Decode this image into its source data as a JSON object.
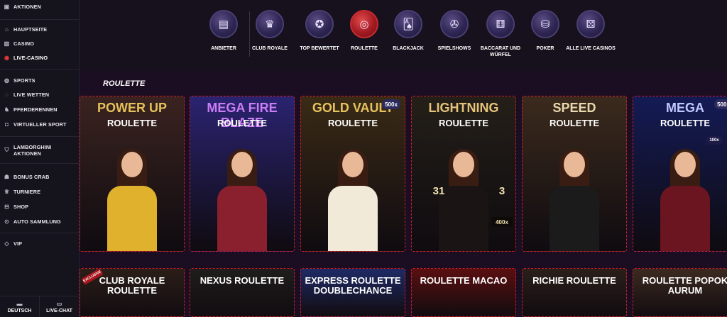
{
  "sidebar": {
    "top_items": [
      {
        "label": "AKTIONEN",
        "icon": "gift-icon"
      }
    ],
    "group1": [
      {
        "label": "HAUPTSEITE",
        "icon": "home-icon"
      },
      {
        "label": "CASINO",
        "icon": "slot-icon"
      },
      {
        "label": "LIVE-CASINO",
        "icon": "roulette-icon"
      }
    ],
    "group2": [
      {
        "label": "SPORTS",
        "icon": "ball-icon"
      },
      {
        "label": "LIVE WETTEN",
        "icon": "live-icon"
      },
      {
        "label": "PFERDERENNEN",
        "icon": "horse-icon"
      },
      {
        "label": "VIRTUELLER SPORT",
        "icon": "controller-icon"
      }
    ],
    "lambo": {
      "line1": "LAMBORGHINI",
      "line2": "AKTIONEN"
    },
    "group3": [
      {
        "label": "BONUS CRAB",
        "icon": "crab-icon"
      },
      {
        "label": "TURNIERE",
        "icon": "trophy-icon"
      },
      {
        "label": "SHOP",
        "icon": "shop-icon"
      },
      {
        "label": "AUTO SAMMLUNG",
        "icon": "car-icon"
      }
    ],
    "vip": {
      "label": "VIP",
      "icon": "vip-icon"
    },
    "bottom": {
      "language": "DEUTSCH",
      "chat": "LIVE-CHAT"
    }
  },
  "categories": [
    {
      "label": "ANBIETER",
      "icon": "provider-icon",
      "glyph": "▤"
    },
    {
      "label": "CLUB ROYALE",
      "icon": "crown-icon",
      "glyph": "♛"
    },
    {
      "label": "TOP BEWERTET",
      "icon": "badge-icon",
      "glyph": "✪"
    },
    {
      "label": "ROULETTE",
      "icon": "roulette-wheel-icon",
      "glyph": "◎",
      "active": true
    },
    {
      "label": "BLACKJACK",
      "icon": "cards-icon",
      "glyph": "🂡"
    },
    {
      "label": "SPIELSHOWS",
      "icon": "wheel-icon",
      "glyph": "✇"
    },
    {
      "label": "BACCARAT UND WÜRFEL",
      "icon": "dice-cards-icon",
      "glyph": "⚅"
    },
    {
      "label": "POKER",
      "icon": "chips-icon",
      "glyph": "⛁"
    },
    {
      "label": "ALLE LIVE CASINOS",
      "icon": "all-live-icon",
      "glyph": "⚄"
    }
  ],
  "section_title": "ROULETTE",
  "games_row1": [
    {
      "caption": "PowerUP Roulette",
      "title1": "POWER UP",
      "title2": "ROULETTE",
      "bg": "#3a2320",
      "accent": "#e4c15a",
      "dress": "#e0b12c"
    },
    {
      "caption": "Mega Fire Blaze Roulette Live",
      "title1": "MEGA FIRE BLAZE",
      "title2": "ROULETTE",
      "bg": "#2a2370",
      "accent": "#c97cf4",
      "dress": "#8a1f2e"
    },
    {
      "caption": "Gold Vault Roulette",
      "title1": "GOLD VAULT",
      "title2": "ROULETTE",
      "bg": "#3a2a16",
      "accent": "#e7c25f",
      "dress": "#f1ead9",
      "badge": "500x"
    },
    {
      "caption": "Lightning Roulette",
      "title1": "LIGHTNING",
      "title2": "ROULETTE",
      "bg": "#241f18",
      "accent": "#e6c27a",
      "dress": "#1a1414",
      "n1": "31",
      "n2": "3",
      "mult": "400x"
    },
    {
      "caption": "Speed Roulette",
      "title1": "SPEED",
      "title2": "ROULETTE",
      "bg": "#3b2a1d",
      "accent": "#e8d9ad",
      "dress": "#1b1b1b"
    },
    {
      "caption": "Mega Roulette",
      "title1": "MEGA",
      "title2": "ROULETTE",
      "bg": "#141b55",
      "accent": "#bfc8ff",
      "dress": "#6b1520",
      "badge": "500x",
      "badge2": "100x"
    }
  ],
  "games_row2": [
    {
      "title": "CLUB ROYALE ROULETTE",
      "tag": "EXCLUSIVE",
      "bg": "#2b1e18"
    },
    {
      "title": "NEXUS ROULETTE",
      "bg": "#1f1d1c"
    },
    {
      "title": "EXPRESS ROULETTE DOUBLECHANCE",
      "bg": "#1e2a66"
    },
    {
      "title": "ROULETTE MACAO",
      "bg": "#5a0f10"
    },
    {
      "title": "RICHIE ROULETTE",
      "bg": "#2a1f1a"
    },
    {
      "title": "ROULETTE POPOK AURUM",
      "bg": "#3c2a20"
    }
  ]
}
